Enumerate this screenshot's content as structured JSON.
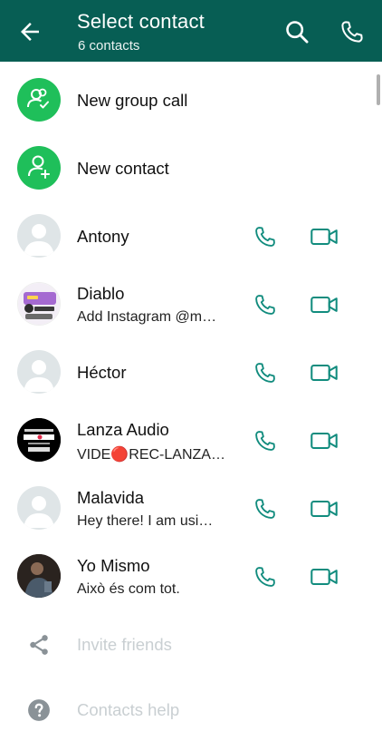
{
  "header": {
    "title": "Select contact",
    "subtitle": "6 contacts",
    "bg_color": "#075e54"
  },
  "actions": [
    {
      "label": "New group call",
      "icon": "group-call-icon"
    },
    {
      "label": "New contact",
      "icon": "add-contact-icon"
    }
  ],
  "contacts": [
    {
      "name": "Antony",
      "status": ""
    },
    {
      "name": "Diablo",
      "status": "Add Instagram @m…"
    },
    {
      "name": "Héctor",
      "status": ""
    },
    {
      "name": "Lanza Audio",
      "status": "VIDE🔴REC-LANZA…"
    },
    {
      "name": "Malavida",
      "status": "Hey there! I am usi…"
    },
    {
      "name": "Yo Mismo",
      "status": "Això és com tot."
    }
  ],
  "footer_items": [
    {
      "label": "Invite friends",
      "icon": "share-icon"
    },
    {
      "label": "Contacts help",
      "icon": "help-icon"
    }
  ],
  "colors": {
    "accent": "#25d366",
    "icon_teal": "#128c7e"
  }
}
